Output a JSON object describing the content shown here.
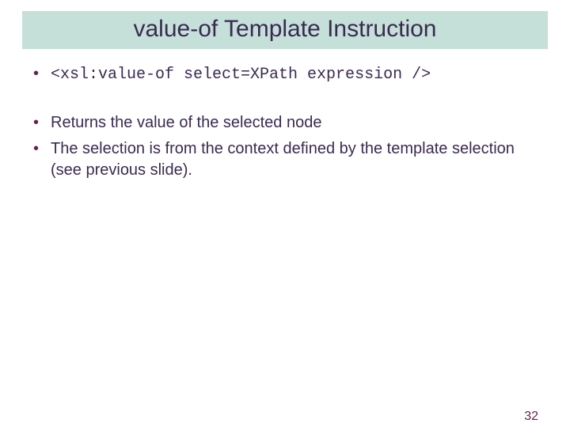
{
  "slide": {
    "title": "value-of Template Instruction",
    "bullets": [
      {
        "type": "code",
        "text": "<xsl:value-of select=XPath expression />"
      },
      {
        "type": "spacer"
      },
      {
        "type": "text",
        "text": "Returns the value of the selected node"
      },
      {
        "type": "text",
        "text": "The selection is from the context defined by the template selection (see previous slide)."
      }
    ],
    "page_number": "32"
  }
}
